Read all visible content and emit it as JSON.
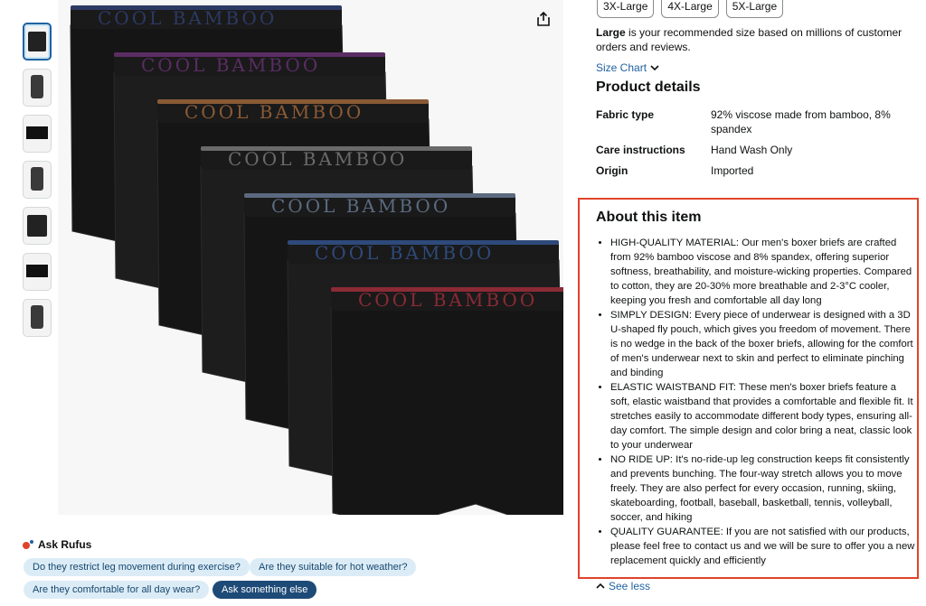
{
  "sizes": [
    "3X-Large",
    "4X-Large",
    "5X-Large"
  ],
  "recommendation": {
    "bold": "Large",
    "text": " is your recommended size based on millions of customer orders and reviews."
  },
  "size_chart": {
    "label": "Size Chart",
    "icon": "chevron-down-icon"
  },
  "product_details": {
    "title": "Product details",
    "rows": [
      {
        "key": "Fabric type",
        "value": "92% viscose made from bamboo, 8% spandex"
      },
      {
        "key": "Care instructions",
        "value": "Hand Wash Only"
      },
      {
        "key": "Origin",
        "value": "Imported"
      }
    ]
  },
  "about": {
    "title": "About this item",
    "bullets": [
      "HIGH-QUALITY MATERIAL: Our men's boxer briefs are crafted from 92% bamboo viscose and 8% spandex, offering superior softness, breathability, and moisture-wicking properties. Compared to cotton, they are 20-30% more breathable and 2-3°C cooler, keeping you fresh and comfortable all day long",
      "SIMPLY DESIGN: Every piece of underwear is designed with a 3D U-shaped fly pouch, which gives you freedom of movement. There is no wedge in the back of the boxer briefs, allowing for the comfort of men's underwear next to skin and perfect to eliminate pinching and binding",
      "ELASTIC WAISTBAND FIT: These men's boxer briefs feature a soft, elastic waistband that provides a comfortable and flexible fit. It stretches easily to accommodate different body types, ensuring all-day comfort. The simple design and color bring a neat, classic look to your underwear",
      "NO RIDE UP: It's no-ride-up leg construction keeps fit consistently and prevents bunching. The four-way stretch allows you to move freely. They are also perfect for every occasion, running, skiing, skateboarding, football, baseball, basketball, tennis, volleyball, soccer, and hiking",
      "QUALITY GUARANTEE: If you are not satisfied with our products, please feel free to contact us and we will be sure to offer you a new replacement quickly and efficiently"
    ]
  },
  "see_less": "See less",
  "rufus": {
    "label": "Ask Rufus",
    "questions": [
      "Do they restrict leg movement during exercise?",
      "Are they suitable for hot weather?",
      "Are they comfortable for all day wear?"
    ],
    "ask_else": "Ask something else"
  },
  "product_image": {
    "waistband_text": "COOL  BAMBOO",
    "waistband_colors": [
      "#2c3a63",
      "#5a2d63",
      "#8a5a36",
      "#6a6a6a",
      "#5b6a80",
      "#2e4a7a",
      "#8a2a35"
    ]
  },
  "colors": {
    "accent": "#2162a1",
    "highlight_border": "#e0432b",
    "chip_bg": "#dcecf7",
    "chip_dark": "#1e4a77"
  }
}
